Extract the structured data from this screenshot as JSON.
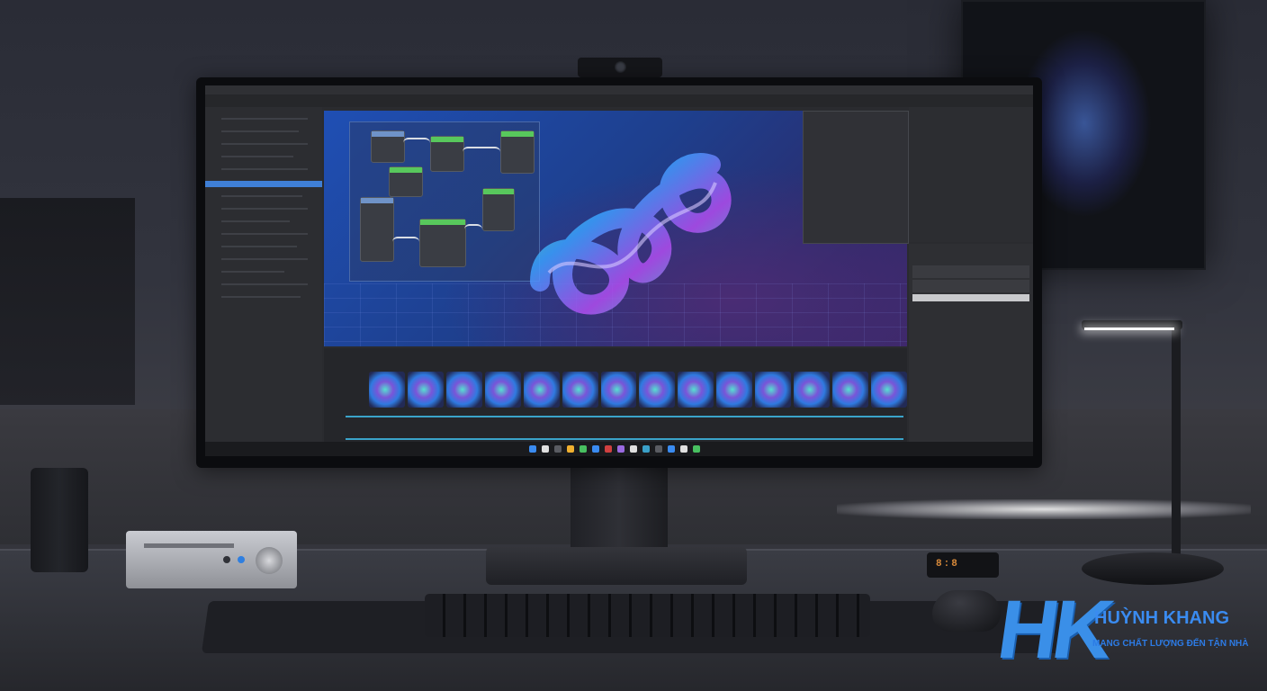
{
  "brand": {
    "logo_letters": "HK",
    "name": "HUỲNH KHANG",
    "tagline": "MANG CHẤT LƯỢNG ĐẾN TẬN NHÀ",
    "accent": "#2c7be5",
    "name_color": "#3a8bf0"
  },
  "scene": {
    "monitor_app": "3D node-based editor with viewport render, timeline filmstrip and property panels",
    "render_colors": [
      "#55f07a",
      "#b04df0",
      "#3aa0ff",
      "#2ee0d6"
    ],
    "clock_display": "8:8"
  },
  "icons": {
    "webcam": "webcam-icon",
    "lamp": "desk-lamp-icon"
  }
}
